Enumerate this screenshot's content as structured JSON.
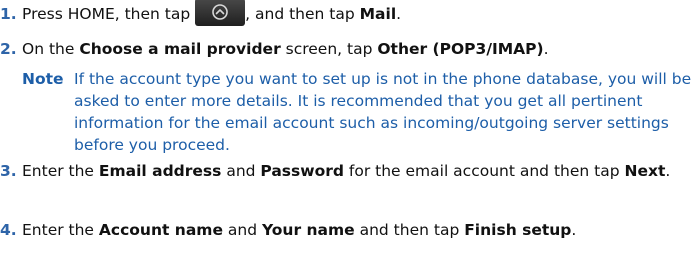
{
  "steps": [
    {
      "number": "1.",
      "text_a": "Press HOME, then tap ",
      "text_b": ", and then tap ",
      "bold": "Mail",
      "text_c": "."
    },
    {
      "number": "2.",
      "text_a": "On the ",
      "bold_a": "Choose a mail provider",
      "text_b": " screen, tap ",
      "bold_b": "Other (POP3/IMAP)",
      "text_c": "."
    },
    {
      "number": "3.",
      "text_a": "Enter the ",
      "bold_a": "Email address",
      "text_b": " and ",
      "bold_b": "Password",
      "text_c": " for the email account and then tap ",
      "bold_c": "Next",
      "text_d": "."
    },
    {
      "number": "4.",
      "text_a": "Enter the ",
      "bold_a": "Account name",
      "text_b": " and ",
      "bold_b": "Your name",
      "text_c": " and then tap ",
      "bold_c": "Finish setup",
      "text_d": "."
    }
  ],
  "note": {
    "label": "Note",
    "text": "If the account type you want to set up is not in the phone database, you will be asked to enter more details. It is recommended that you get all pertinent information for the email account such as incoming/outgoing server settings before you proceed."
  },
  "icons": {
    "all_apps_button": "all-apps-icon"
  },
  "colors": {
    "step_number": "#2e64a8",
    "note_text": "#1d5ea8",
    "body_text": "#111111"
  }
}
